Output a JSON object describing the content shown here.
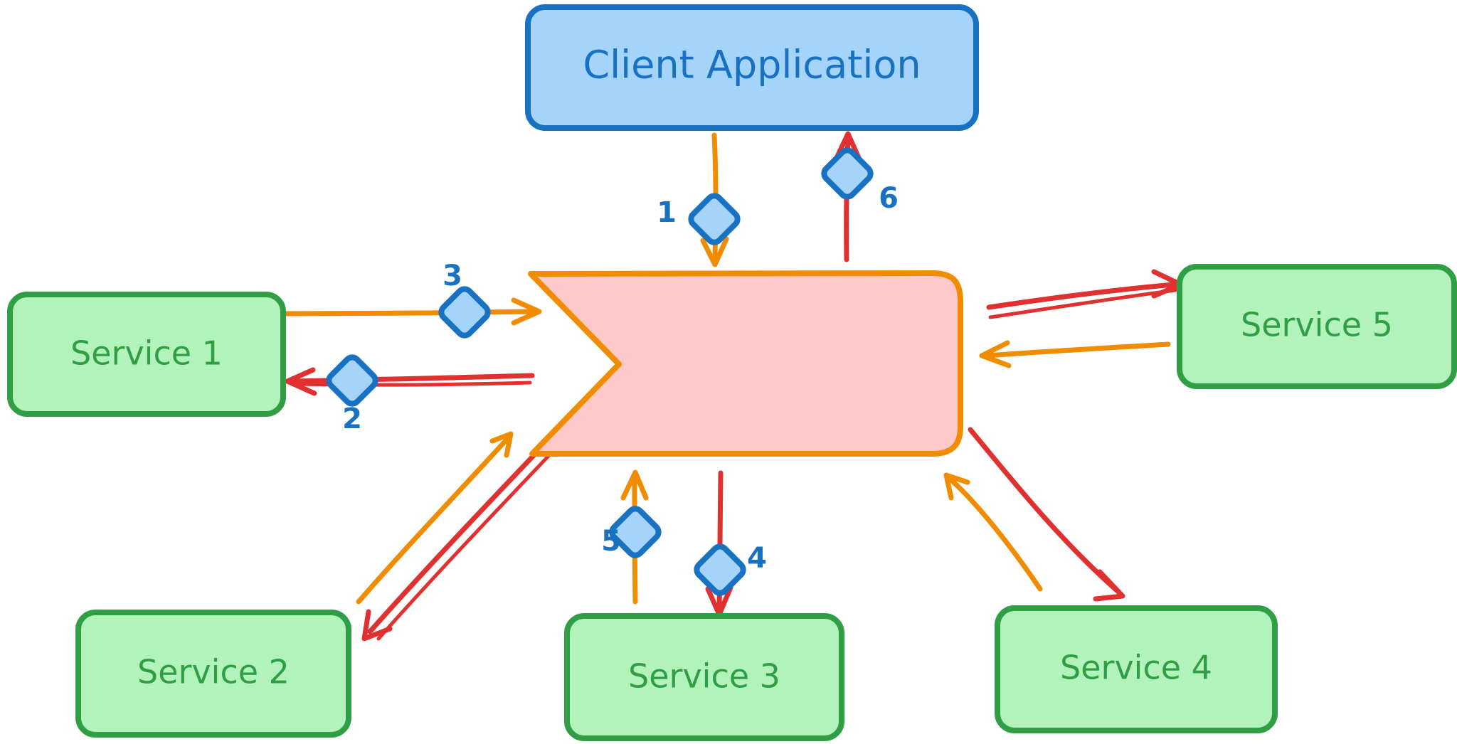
{
  "diagram": {
    "title_node": {
      "label": "Client Application"
    },
    "gateway": {
      "label": ""
    },
    "services": [
      {
        "id": "service-1",
        "label": "Service 1"
      },
      {
        "id": "service-2",
        "label": "Service 2"
      },
      {
        "id": "service-3",
        "label": "Service 3"
      },
      {
        "id": "service-4",
        "label": "Service 4"
      },
      {
        "id": "service-5",
        "label": "Service 5"
      }
    ],
    "sequence_markers": [
      {
        "id": "marker-1",
        "label": "1"
      },
      {
        "id": "marker-2",
        "label": "2"
      },
      {
        "id": "marker-3",
        "label": "3"
      },
      {
        "id": "marker-4",
        "label": "4"
      },
      {
        "id": "marker-5",
        "label": "5"
      },
      {
        "id": "marker-6",
        "label": "6"
      }
    ],
    "colors": {
      "client_fill": "#a5d4fb",
      "client_stroke": "#1971c2",
      "client_text": "#1971c2",
      "gateway_fill": "#ffc9c9",
      "gateway_stroke": "#f08c00",
      "service_fill": "#b2f2bb",
      "service_stroke": "#2f9e44",
      "service_text": "#2f9e44",
      "arrow_orange": "#f08c00",
      "arrow_red": "#e03131",
      "marker_fill": "#a5d4fb",
      "marker_stroke": "#1971c2",
      "marker_text": "#1971c2",
      "background": "#ffffff"
    }
  }
}
